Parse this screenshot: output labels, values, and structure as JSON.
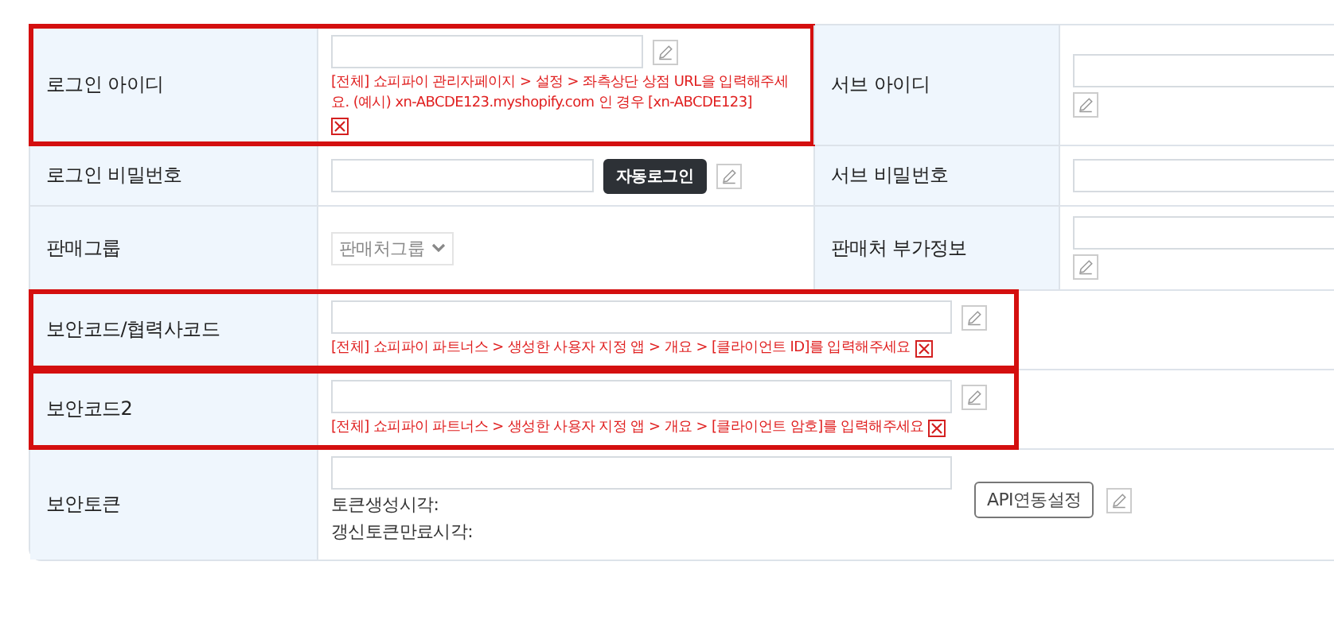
{
  "rows": [
    {
      "kind": "pair",
      "fields": [
        {
          "label": "로그인 아이디",
          "highlighted": true,
          "parts": [
            {
              "kind": "input"
            },
            {
              "kind": "edit"
            },
            {
              "kind": "hint",
              "text": "[전체] 쇼피파이 관리자페이지 > 설정 > 좌측상단 상점 URL을 입력해주세요. (예시) xn-ABCDE123.myshopify.com 인 경우 [xn-ABCDE123]"
            }
          ]
        },
        {
          "label": "서브 아이디",
          "highlighted": false,
          "parts": [
            {
              "kind": "input"
            },
            {
              "kind": "edit"
            }
          ]
        }
      ]
    },
    {
      "kind": "pair",
      "fields": [
        {
          "label": "로그인 비밀번호",
          "highlighted": false,
          "parts": [
            {
              "kind": "input"
            },
            {
              "kind": "button",
              "text": "자동로그인"
            },
            {
              "kind": "edit"
            }
          ]
        },
        {
          "label": "서브 비밀번호",
          "highlighted": false,
          "parts": [
            {
              "kind": "input"
            }
          ]
        }
      ]
    },
    {
      "kind": "pair",
      "fields": [
        {
          "label": "판매그룹",
          "highlighted": false,
          "parts": [
            {
              "kind": "select",
              "text": "판매처그룹"
            }
          ]
        },
        {
          "label": "판매처 부가정보",
          "highlighted": false,
          "parts": [
            {
              "kind": "input"
            },
            {
              "kind": "edit"
            }
          ]
        }
      ]
    },
    {
      "kind": "single",
      "fields": [
        {
          "label": "보안코드/협력사코드",
          "highlighted": true,
          "parts": [
            {
              "kind": "input"
            },
            {
              "kind": "edit"
            },
            {
              "kind": "hint",
              "text": "[전체] 쇼피파이 파트너스 > 생성한 사용자 지정 앱 > 개요 > [클라이언트 ID]를 입력해주세요"
            }
          ]
        }
      ]
    },
    {
      "kind": "single",
      "fields": [
        {
          "label": "보안코드2",
          "highlighted": true,
          "parts": [
            {
              "kind": "input"
            },
            {
              "kind": "edit"
            },
            {
              "kind": "hint",
              "text": "[전체] 쇼피파이 파트너스 > 생성한 사용자 지정 앱 > 개요 > [클라이언트 암호]를 입력해주세요"
            }
          ]
        }
      ]
    },
    {
      "kind": "last",
      "fields": [
        {
          "label": "보안토큰",
          "highlighted": false,
          "parts": [
            {
              "kind": "input"
            },
            {
              "kind": "text",
              "text": "토큰생성시각:"
            },
            {
              "kind": "text",
              "text": "갱신토큰만료시각:"
            },
            {
              "kind": "button",
              "text": "API연동설정"
            },
            {
              "kind": "edit"
            }
          ]
        }
      ]
    }
  ]
}
